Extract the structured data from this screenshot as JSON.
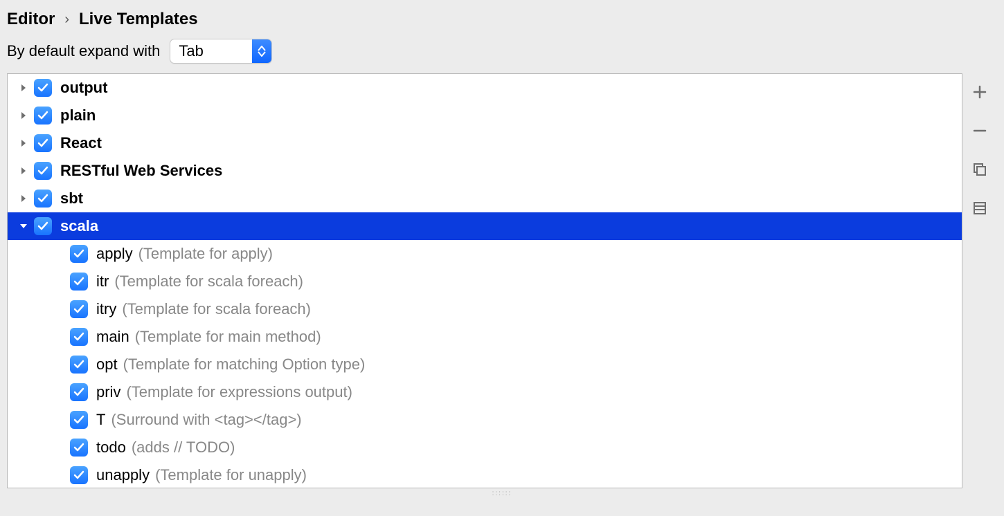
{
  "breadcrumb": {
    "parent": "Editor",
    "current": "Live Templates"
  },
  "expand": {
    "label": "By default expand with",
    "value": "Tab"
  },
  "groups": [
    {
      "name": "output",
      "expanded": false,
      "checked": true,
      "selected": false
    },
    {
      "name": "plain",
      "expanded": false,
      "checked": true,
      "selected": false
    },
    {
      "name": "React",
      "expanded": false,
      "checked": true,
      "selected": false
    },
    {
      "name": "RESTful Web Services",
      "expanded": false,
      "checked": true,
      "selected": false
    },
    {
      "name": "sbt",
      "expanded": false,
      "checked": true,
      "selected": false
    },
    {
      "name": "scala",
      "expanded": true,
      "checked": true,
      "selected": true,
      "children": [
        {
          "name": "apply",
          "desc": "(Template for apply)",
          "checked": true
        },
        {
          "name": "itr",
          "desc": "(Template for scala foreach)",
          "checked": true
        },
        {
          "name": "itry",
          "desc": "(Template for scala foreach)",
          "checked": true
        },
        {
          "name": "main",
          "desc": "(Template for main method)",
          "checked": true
        },
        {
          "name": "opt",
          "desc": "(Template for matching Option type)",
          "checked": true
        },
        {
          "name": "priv",
          "desc": "(Template for expressions output)",
          "checked": true
        },
        {
          "name": "T",
          "desc": "(Surround with <tag></tag>)",
          "checked": true
        },
        {
          "name": "todo",
          "desc": "(adds // TODO)",
          "checked": true
        },
        {
          "name": "unapply",
          "desc": "(Template for unapply)",
          "checked": true
        }
      ]
    }
  ]
}
